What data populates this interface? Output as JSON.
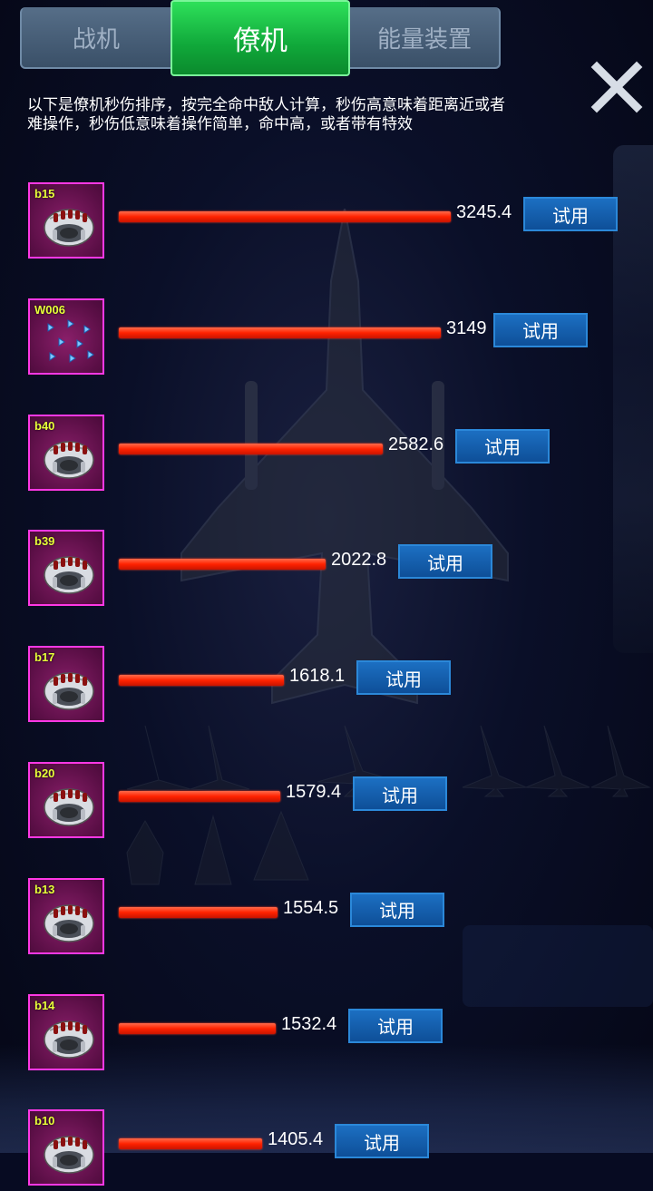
{
  "tabs": [
    {
      "label": "战机",
      "active": false
    },
    {
      "label": "僚机",
      "active": true
    },
    {
      "label": "能量装置",
      "active": false
    }
  ],
  "description": "以下是僚机秒伤排序，按完全命中敌人计算，秒伤高意味着距离近或者难操作，秒伤低意味着操作简单，命中高，或者带有特效",
  "try_label": "试用",
  "max_value": 3245.4,
  "colors": {
    "bar": "#ff2200",
    "icon_border": "#ff38e4",
    "tab_active": "#10a83a",
    "button": "#0e4f98"
  },
  "wingmen": [
    {
      "id": "b15",
      "dps": 3245.4,
      "dps_text": "3245.4",
      "icon": "missile-pod-icon"
    },
    {
      "id": "W006",
      "dps": 3149,
      "dps_text": "3149",
      "icon": "blue-drones-icon"
    },
    {
      "id": "b40",
      "dps": 2582.6,
      "dps_text": "2582.6",
      "icon": "missile-pod-icon"
    },
    {
      "id": "b39",
      "dps": 2022.8,
      "dps_text": "2022.8",
      "icon": "missile-pod-icon"
    },
    {
      "id": "b17",
      "dps": 1618.1,
      "dps_text": "1618.1",
      "icon": "missile-pod-icon"
    },
    {
      "id": "b20",
      "dps": 1579.4,
      "dps_text": "1579.4",
      "icon": "missile-pod-icon"
    },
    {
      "id": "b13",
      "dps": 1554.5,
      "dps_text": "1554.5",
      "icon": "missile-pod-icon"
    },
    {
      "id": "b14",
      "dps": 1532.4,
      "dps_text": "1532.4",
      "icon": "missile-pod-icon"
    },
    {
      "id": "b10",
      "dps": 1405.4,
      "dps_text": "1405.4",
      "icon": "missile-pod-icon"
    }
  ]
}
